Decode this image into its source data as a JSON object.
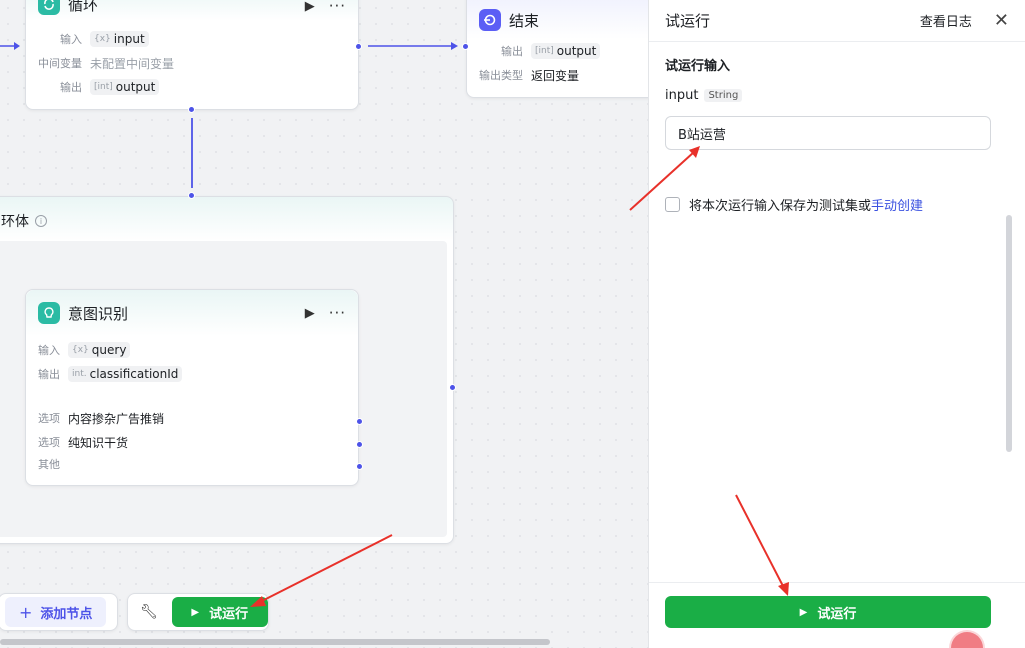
{
  "loop_node": {
    "title": "循环",
    "rows": [
      {
        "label": "输入",
        "type": "{x}",
        "value": "input"
      },
      {
        "label": "中间变量",
        "value": "未配置中间变量"
      },
      {
        "label": "输出",
        "type": "[int]",
        "value": "output"
      }
    ]
  },
  "end_node": {
    "title": "结束",
    "rows": [
      {
        "label": "输出",
        "type": "[int]",
        "value": "output"
      },
      {
        "label": "输出类型",
        "value": "返回变量"
      }
    ]
  },
  "loop_body": {
    "title": "环体"
  },
  "intent_node": {
    "title": "意图识别",
    "rows": [
      {
        "label": "输入",
        "type": "{x}",
        "value": "query"
      },
      {
        "label": "输出",
        "type": "int.",
        "value": "classificationId"
      }
    ],
    "options": [
      {
        "label": "选项",
        "value": "内容掺杂广告推销"
      },
      {
        "label": "选项",
        "value": "纯知识干货"
      },
      {
        "label": "其他",
        "value": ""
      }
    ]
  },
  "toolbar": {
    "add_node_label": "添加节点",
    "run_label": "试运行"
  },
  "panel": {
    "title": "试运行",
    "view_logs": "查看日志",
    "section_title": "试运行输入",
    "field_name": "input",
    "field_type": "String",
    "field_value": "B站运营",
    "save_text": "将本次运行输入保存为测试集或",
    "save_link": "手动创建",
    "run_button": "试运行"
  },
  "colors": {
    "accent": "#4d53e8",
    "run_green": "#1aae46",
    "intent_icon": "#2bbba4",
    "loop_icon": "#2bbba4",
    "end_icon": "#5b5ef5",
    "annotation_red": "#e8312a"
  }
}
